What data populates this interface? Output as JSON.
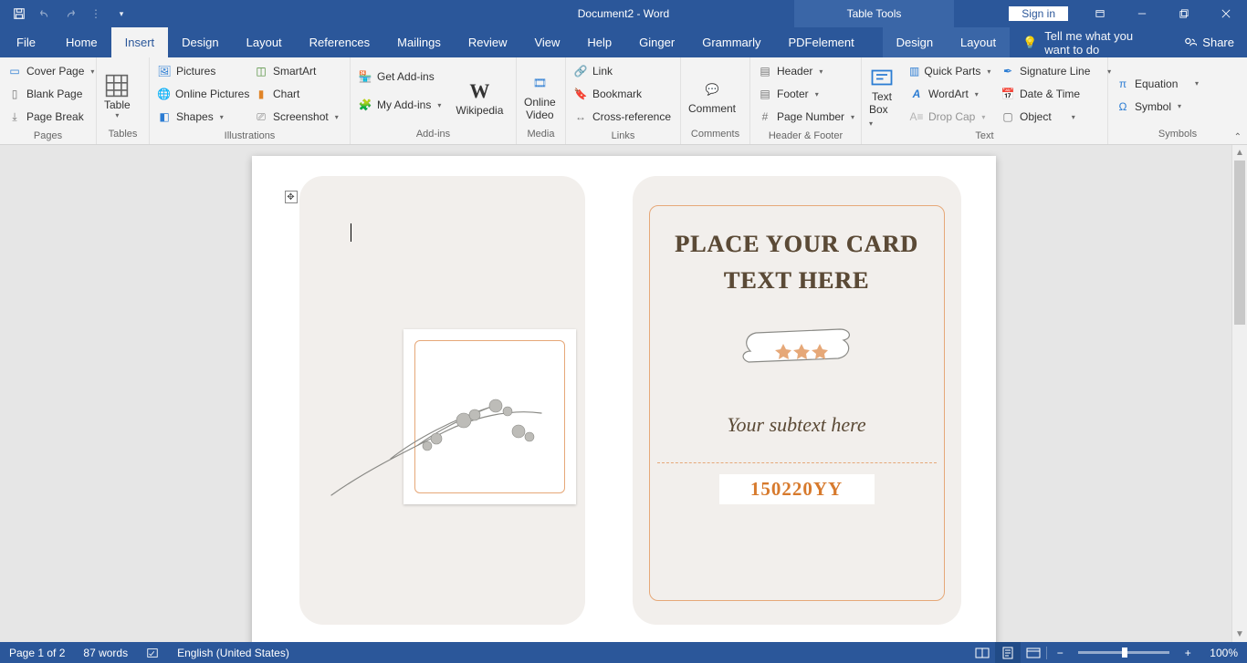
{
  "titlebar": {
    "doc_title": "Document2 - Word",
    "tools_context": "Table Tools",
    "sign_in": "Sign in"
  },
  "tabs": {
    "items": [
      "File",
      "Home",
      "Insert",
      "Design",
      "Layout",
      "References",
      "Mailings",
      "Review",
      "View",
      "Help",
      "Ginger",
      "Grammarly",
      "PDFelement"
    ],
    "context_items": [
      "Design",
      "Layout"
    ],
    "active": "Insert",
    "tell_me": "Tell me what you want to do",
    "share": "Share"
  },
  "ribbon": {
    "pages": {
      "label": "Pages",
      "cover": "Cover Page",
      "blank": "Blank Page",
      "break": "Page Break"
    },
    "tables": {
      "label": "Tables",
      "table": "Table"
    },
    "illustrations": {
      "label": "Illustrations",
      "pictures": "Pictures",
      "online_pictures": "Online Pictures",
      "shapes": "Shapes",
      "smartart": "SmartArt",
      "chart": "Chart",
      "screenshot": "Screenshot"
    },
    "addins": {
      "label": "Add-ins",
      "get": "Get Add-ins",
      "my": "My Add-ins",
      "wikipedia": "Wikipedia"
    },
    "media": {
      "label": "Media",
      "online_video_l1": "Online",
      "online_video_l2": "Video"
    },
    "links": {
      "label": "Links",
      "link": "Link",
      "bookmark": "Bookmark",
      "crossref": "Cross-reference"
    },
    "comments": {
      "label": "Comments",
      "comment": "Comment"
    },
    "headerfooter": {
      "label": "Header & Footer",
      "header": "Header",
      "footer": "Footer",
      "pagenum": "Page Number"
    },
    "text": {
      "label": "Text",
      "textbox_l1": "Text",
      "textbox_l2": "Box",
      "quick": "Quick Parts",
      "wordart": "WordArt",
      "dropcap": "Drop Cap",
      "sig": "Signature Line",
      "date": "Date & Time",
      "object": "Object"
    },
    "symbols": {
      "label": "Symbols",
      "equation": "Equation",
      "symbol": "Symbol"
    }
  },
  "document": {
    "card_title": "PLACE YOUR CARD TEXT HERE",
    "subtext": "Your subtext here",
    "code": "150220YY"
  },
  "statusbar": {
    "page": "Page 1 of 2",
    "words": "87 words",
    "language": "English (United States)",
    "zoom": "100%"
  }
}
